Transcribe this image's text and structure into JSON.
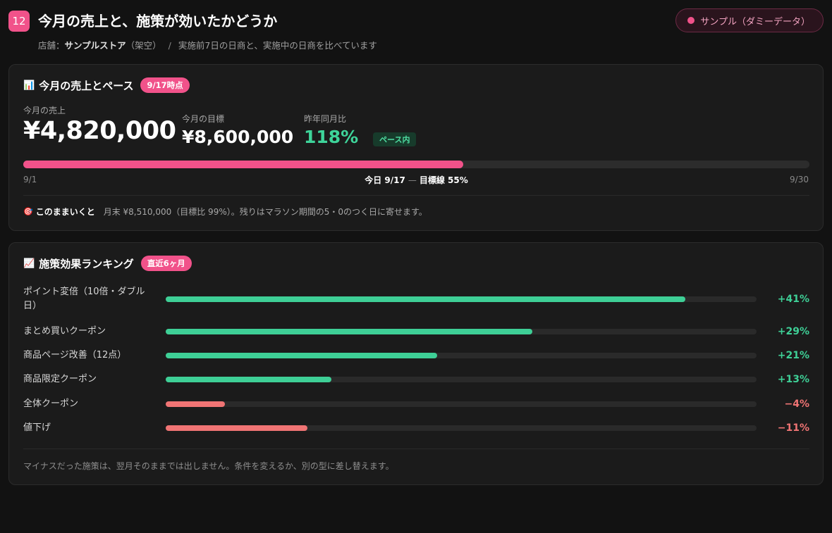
{
  "header": {
    "number": "12",
    "title": "今月の売上と、施策が効いたかどうか",
    "store_label": "店舗：",
    "store_name": "サンプルストア",
    "store_note": "（架空）",
    "separator": "/",
    "description": "実施前7日の日商と、実施中の日商を比べています",
    "sample_label": "サンプル（ダミーデータ）"
  },
  "sales_card": {
    "icon": "📊",
    "title": "今月の売上とペース",
    "date_badge": "9/17時点",
    "current_label": "今月の売上",
    "current_value": "¥4,820,000",
    "target_label": "今月の目標",
    "target_value": "¥8,600,000",
    "yoy_label": "昨年同月比",
    "yoy_value": "118%",
    "pace_badge": "ペース内",
    "progress_fraction": 0.56,
    "tick_start": "9/1",
    "tick_end": "9/30",
    "today_label": "今日 9/17",
    "today_dash": "—",
    "target_line_label": "目標線 55%",
    "forecast_icon": "🎯",
    "forecast_label": "このままいくと",
    "forecast_text": "月末 ¥8,510,000（目標比 99%）。残りはマラソン期間の5・0のつく日に寄せます。"
  },
  "ranking_card": {
    "icon": "📈",
    "title": "施策効果ランキング",
    "period_badge": "直近6ヶ月",
    "colors": {
      "positive": "#3ecf96",
      "negative": "#f07474"
    },
    "items": [
      {
        "name": "ポイント変倍（10倍・ダブル日）",
        "value": "+41%",
        "fraction": 0.88,
        "sign": "positive"
      },
      {
        "name": "まとめ買いクーポン",
        "value": "+29%",
        "fraction": 0.62,
        "sign": "positive"
      },
      {
        "name": "商品ページ改善（12点）",
        "value": "+21%",
        "fraction": 0.46,
        "sign": "positive"
      },
      {
        "name": "商品限定クーポン",
        "value": "+13%",
        "fraction": 0.28,
        "sign": "positive"
      },
      {
        "name": "全体クーポン",
        "value": "−4%",
        "fraction": 0.1,
        "sign": "negative"
      },
      {
        "name": "値下げ",
        "value": "−11%",
        "fraction": 0.24,
        "sign": "negative"
      }
    ],
    "note": "マイナスだった施策は、翌月そのままでは出しません。条件を変えるか、別の型に差し替えます。"
  }
}
